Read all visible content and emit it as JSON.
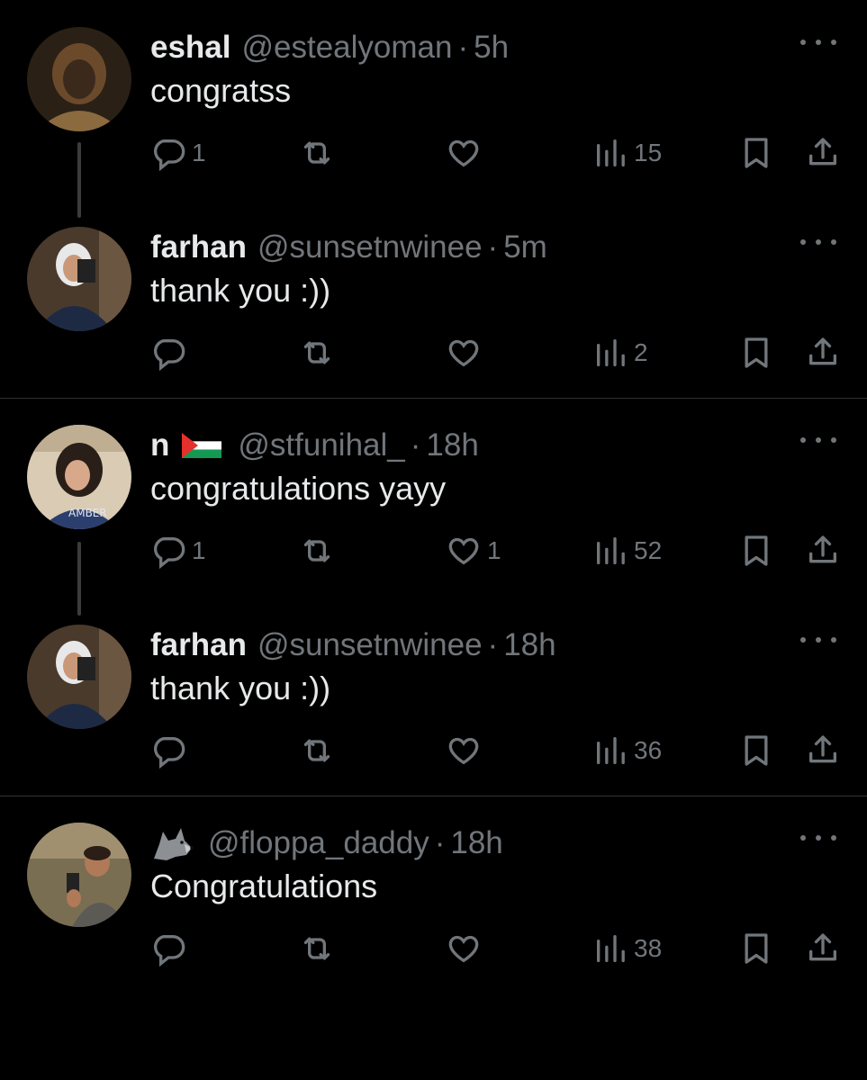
{
  "tweets": [
    {
      "name": "eshal",
      "handle": "@estealyoman",
      "dot": "·",
      "time": "5h",
      "text": "congratss",
      "replies": "1",
      "likes": "",
      "views": "15"
    },
    {
      "name": "farhan",
      "handle": "@sunsetnwinee",
      "dot": "·",
      "time": "5m",
      "text": "thank you :))",
      "replies": "",
      "likes": "",
      "views": "2"
    },
    {
      "name": "n",
      "handle": "@stfunihal_",
      "dot": "·",
      "time": "18h",
      "text": "congratulations yayy",
      "replies": "1",
      "likes": "1",
      "views": "52"
    },
    {
      "name": "farhan",
      "handle": "@sunsetnwinee",
      "dot": "·",
      "time": "18h",
      "text": "thank you :))",
      "replies": "",
      "likes": "",
      "views": "36"
    },
    {
      "name": "",
      "handle": "@floppa_daddy",
      "dot": "·",
      "time": "18h",
      "text": "Congratulations",
      "replies": "",
      "likes": "",
      "views": "38"
    }
  ],
  "icons": {
    "reply": "reply-icon",
    "retweet": "retweet-icon",
    "like": "heart-icon",
    "views": "views-icon",
    "bookmark": "bookmark-icon",
    "share": "share-icon",
    "more": "more-icon"
  },
  "colors": {
    "background": "#000000",
    "text": "#e7e9ea",
    "secondary": "#71767b",
    "divider": "#2f3336"
  }
}
